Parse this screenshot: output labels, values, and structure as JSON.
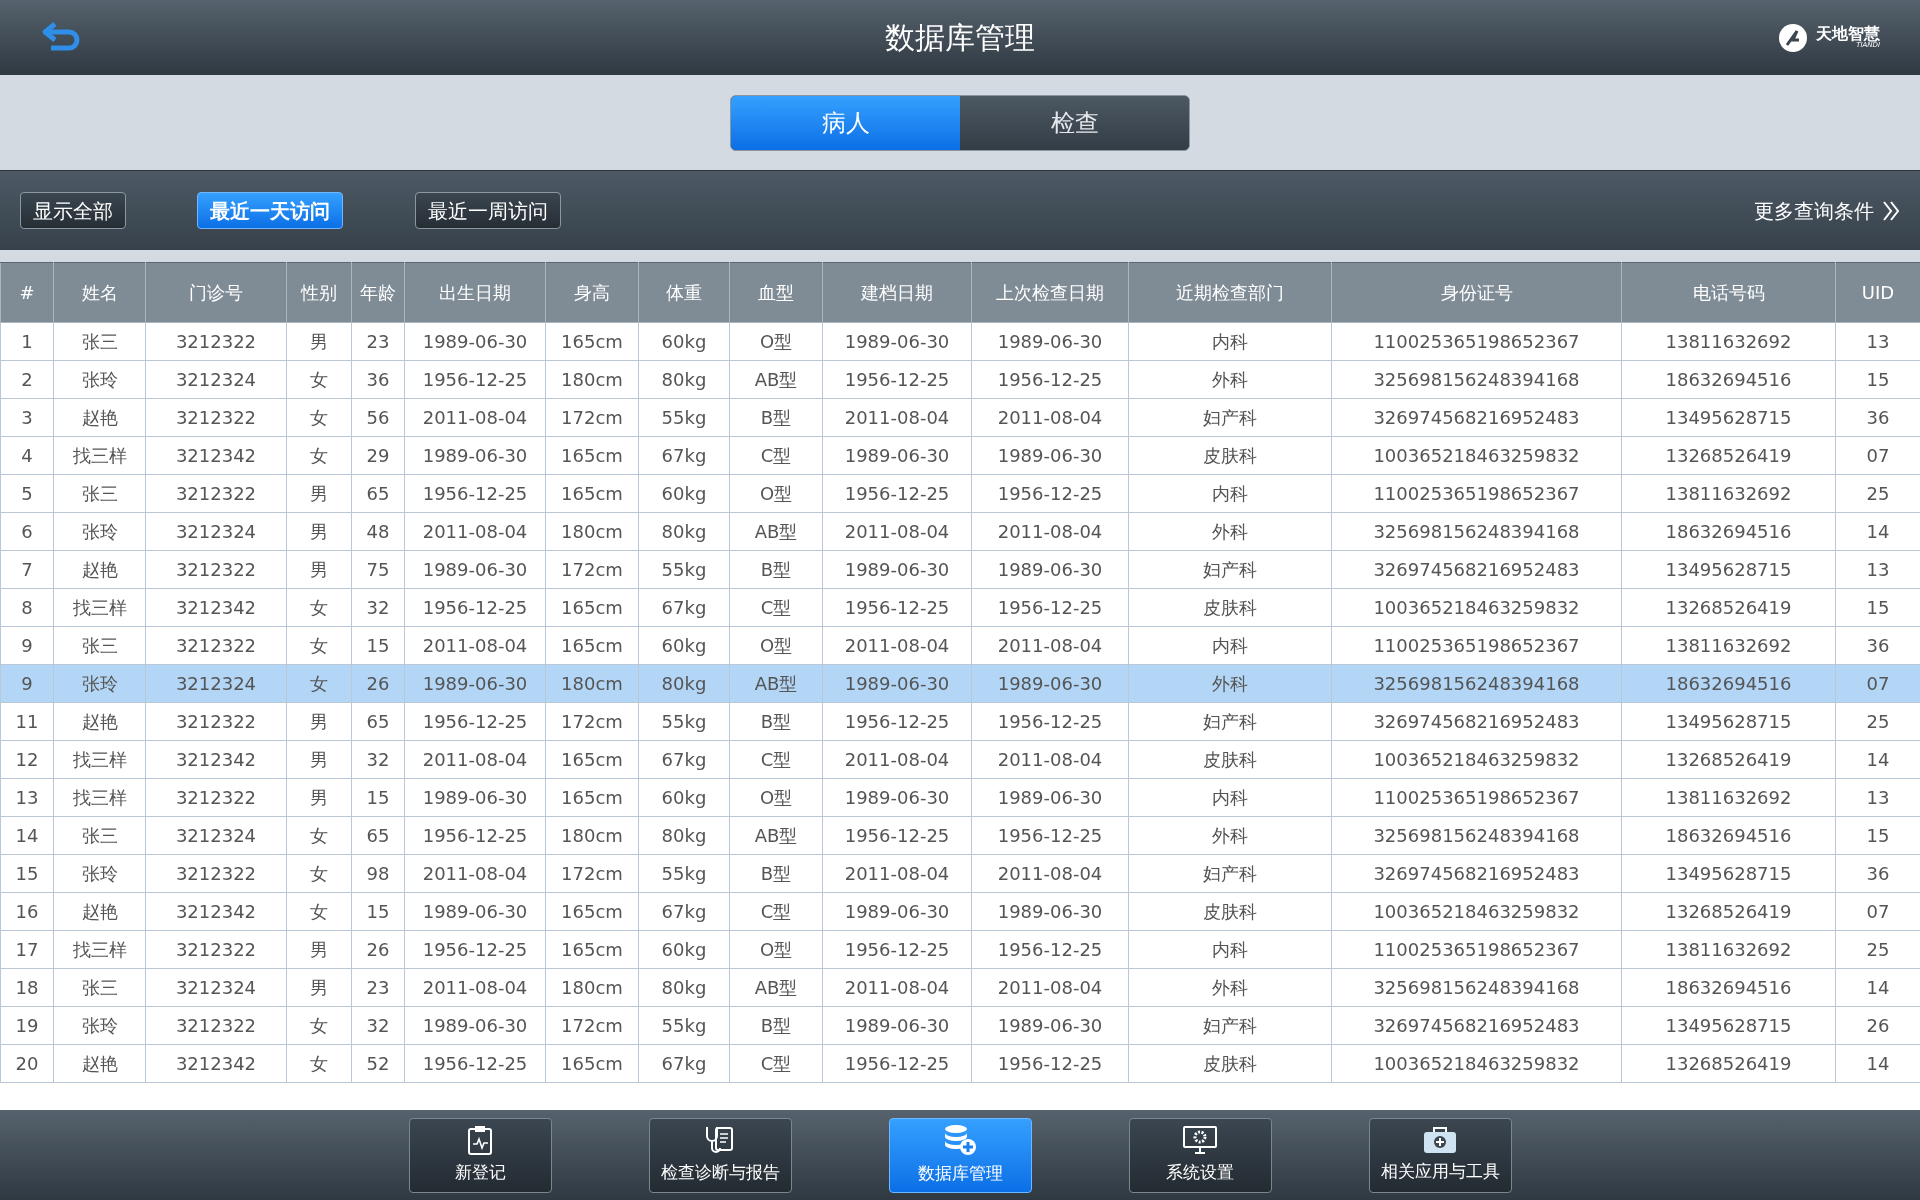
{
  "header": {
    "title": "数据库管理",
    "logo_text": "天地智慧",
    "logo_subtext": "TIANDI"
  },
  "tabs": [
    {
      "label": "病人",
      "selected": true
    },
    {
      "label": "检查",
      "selected": false
    }
  ],
  "filters": [
    {
      "label": "显示全部",
      "selected": false
    },
    {
      "label": "最近一天访问",
      "selected": true
    },
    {
      "label": "最近一周访问",
      "selected": false
    }
  ],
  "more_filters": "更多查询条件",
  "table": {
    "columns": [
      "#",
      "姓名",
      "门诊号",
      "性别",
      "年龄",
      "出生日期",
      "身高",
      "体重",
      "血型",
      "建档日期",
      "上次检查日期",
      "近期检查部门",
      "身份证号",
      "电话号码",
      "UID"
    ],
    "rows": [
      {
        "selected": false,
        "cells": [
          "1",
          "张三",
          "3212322",
          "男",
          "23",
          "1989-06-30",
          "165cm",
          "60kg",
          "O型",
          "1989-06-30",
          "1989-06-30",
          "内科",
          "110025365198652367",
          "13811632692",
          "13"
        ]
      },
      {
        "selected": false,
        "cells": [
          "2",
          "张玲",
          "3212324",
          "女",
          "36",
          "1956-12-25",
          "180cm",
          "80kg",
          "AB型",
          "1956-12-25",
          "1956-12-25",
          "外科",
          "325698156248394168",
          "18632694516",
          "15"
        ]
      },
      {
        "selected": false,
        "cells": [
          "3",
          "赵艳",
          "3212322",
          "女",
          "56",
          "2011-08-04",
          "172cm",
          "55kg",
          "B型",
          "2011-08-04",
          "2011-08-04",
          "妇产科",
          "326974568216952483",
          "13495628715",
          "36"
        ]
      },
      {
        "selected": false,
        "cells": [
          "4",
          "找三样",
          "3212342",
          "女",
          "29",
          "1989-06-30",
          "165cm",
          "67kg",
          "C型",
          "1989-06-30",
          "1989-06-30",
          "皮肤科",
          "100365218463259832",
          "13268526419",
          "07"
        ]
      },
      {
        "selected": false,
        "cells": [
          "5",
          "张三",
          "3212322",
          "男",
          "65",
          "1956-12-25",
          "165cm",
          "60kg",
          "O型",
          "1956-12-25",
          "1956-12-25",
          "内科",
          "110025365198652367",
          "13811632692",
          "25"
        ]
      },
      {
        "selected": false,
        "cells": [
          "6",
          "张玲",
          "3212324",
          "男",
          "48",
          "2011-08-04",
          "180cm",
          "80kg",
          "AB型",
          "2011-08-04",
          "2011-08-04",
          "外科",
          "325698156248394168",
          "18632694516",
          "14"
        ]
      },
      {
        "selected": false,
        "cells": [
          "7",
          "赵艳",
          "3212322",
          "男",
          "75",
          "1989-06-30",
          "172cm",
          "55kg",
          "B型",
          "1989-06-30",
          "1989-06-30",
          "妇产科",
          "326974568216952483",
          "13495628715",
          "13"
        ]
      },
      {
        "selected": false,
        "cells": [
          "8",
          "找三样",
          "3212342",
          "女",
          "32",
          "1956-12-25",
          "165cm",
          "67kg",
          "C型",
          "1956-12-25",
          "1956-12-25",
          "皮肤科",
          "100365218463259832",
          "13268526419",
          "15"
        ]
      },
      {
        "selected": false,
        "cells": [
          "9",
          "张三",
          "3212322",
          "女",
          "15",
          "2011-08-04",
          "165cm",
          "60kg",
          "O型",
          "2011-08-04",
          "2011-08-04",
          "内科",
          "110025365198652367",
          "13811632692",
          "36"
        ]
      },
      {
        "selected": true,
        "cells": [
          "9",
          "张玲",
          "3212324",
          "女",
          "26",
          "1989-06-30",
          "180cm",
          "80kg",
          "AB型",
          "1989-06-30",
          "1989-06-30",
          "外科",
          "325698156248394168",
          "18632694516",
          "07"
        ]
      },
      {
        "selected": false,
        "cells": [
          "11",
          "赵艳",
          "3212322",
          "男",
          "65",
          "1956-12-25",
          "172cm",
          "55kg",
          "B型",
          "1956-12-25",
          "1956-12-25",
          "妇产科",
          "326974568216952483",
          "13495628715",
          "25"
        ]
      },
      {
        "selected": false,
        "cells": [
          "12",
          "找三样",
          "3212342",
          "男",
          "32",
          "2011-08-04",
          "165cm",
          "67kg",
          "C型",
          "2011-08-04",
          "2011-08-04",
          "皮肤科",
          "100365218463259832",
          "13268526419",
          "14"
        ]
      },
      {
        "selected": false,
        "cells": [
          "13",
          "找三样",
          "3212322",
          "男",
          "15",
          "1989-06-30",
          "165cm",
          "60kg",
          "O型",
          "1989-06-30",
          "1989-06-30",
          "内科",
          "110025365198652367",
          "13811632692",
          "13"
        ]
      },
      {
        "selected": false,
        "cells": [
          "14",
          "张三",
          "3212324",
          "女",
          "65",
          "1956-12-25",
          "180cm",
          "80kg",
          "AB型",
          "1956-12-25",
          "1956-12-25",
          "外科",
          "325698156248394168",
          "18632694516",
          "15"
        ]
      },
      {
        "selected": false,
        "cells": [
          "15",
          "张玲",
          "3212322",
          "女",
          "98",
          "2011-08-04",
          "172cm",
          "55kg",
          "B型",
          "2011-08-04",
          "2011-08-04",
          "妇产科",
          "326974568216952483",
          "13495628715",
          "36"
        ]
      },
      {
        "selected": false,
        "cells": [
          "16",
          "赵艳",
          "3212342",
          "女",
          "15",
          "1989-06-30",
          "165cm",
          "67kg",
          "C型",
          "1989-06-30",
          "1989-06-30",
          "皮肤科",
          "100365218463259832",
          "13268526419",
          "07"
        ]
      },
      {
        "selected": false,
        "cells": [
          "17",
          "找三样",
          "3212322",
          "男",
          "26",
          "1956-12-25",
          "165cm",
          "60kg",
          "O型",
          "1956-12-25",
          "1956-12-25",
          "内科",
          "110025365198652367",
          "13811632692",
          "25"
        ]
      },
      {
        "selected": false,
        "cells": [
          "18",
          "张三",
          "3212324",
          "男",
          "23",
          "2011-08-04",
          "180cm",
          "80kg",
          "AB型",
          "2011-08-04",
          "2011-08-04",
          "外科",
          "325698156248394168",
          "18632694516",
          "14"
        ]
      },
      {
        "selected": false,
        "cells": [
          "19",
          "张玲",
          "3212322",
          "女",
          "32",
          "1989-06-30",
          "172cm",
          "55kg",
          "B型",
          "1989-06-30",
          "1989-06-30",
          "妇产科",
          "326974568216952483",
          "13495628715",
          "26"
        ]
      },
      {
        "selected": false,
        "cells": [
          "20",
          "赵艳",
          "3212342",
          "女",
          "52",
          "1956-12-25",
          "165cm",
          "67kg",
          "C型",
          "1956-12-25",
          "1956-12-25",
          "皮肤科",
          "100365218463259832",
          "13268526419",
          "14"
        ]
      }
    ]
  },
  "bottom_nav": [
    {
      "label": "新登记",
      "selected": false
    },
    {
      "label": "检查诊断与报告",
      "selected": false
    },
    {
      "label": "数据库管理",
      "selected": true
    },
    {
      "label": "系统设置",
      "selected": false
    },
    {
      "label": "相关应用与工具",
      "selected": false
    }
  ]
}
